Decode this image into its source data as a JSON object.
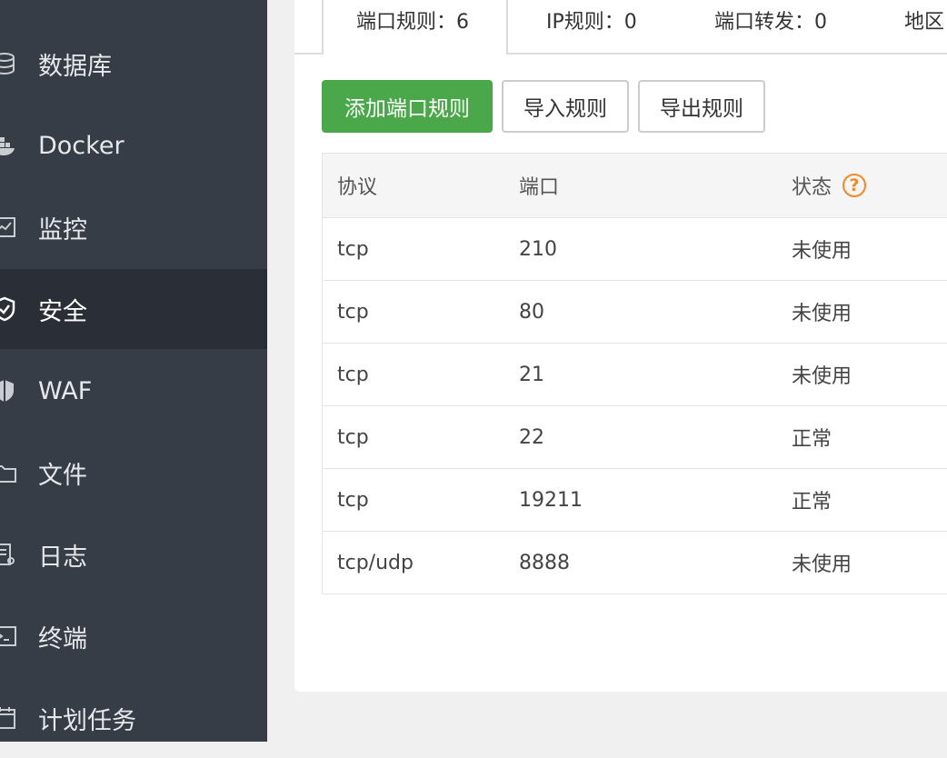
{
  "sidebar": {
    "items": [
      {
        "label": "数据库",
        "icon": "database-icon"
      },
      {
        "label": "Docker",
        "icon": "docker-icon"
      },
      {
        "label": "监控",
        "icon": "monitor-icon"
      },
      {
        "label": "安全",
        "icon": "shield-icon",
        "active": true
      },
      {
        "label": "WAF",
        "icon": "waf-icon"
      },
      {
        "label": "文件",
        "icon": "folder-icon"
      },
      {
        "label": "日志",
        "icon": "log-icon"
      },
      {
        "label": "终端",
        "icon": "terminal-icon"
      },
      {
        "label": "计划任务",
        "icon": "calendar-icon"
      }
    ]
  },
  "tabs": [
    {
      "label": "端口规则：6",
      "active": true
    },
    {
      "label": "IP规则：0"
    },
    {
      "label": "端口转发：0"
    },
    {
      "label": "地区"
    }
  ],
  "toolbar": {
    "add_label": "添加端口规则",
    "import_label": "导入规则",
    "export_label": "导出规则"
  },
  "table": {
    "headers": [
      "协议",
      "端口",
      "状态"
    ],
    "help_glyph": "?",
    "rows": [
      {
        "protocol": "tcp",
        "port": "210",
        "status": "未使用"
      },
      {
        "protocol": "tcp",
        "port": "80",
        "status": "未使用"
      },
      {
        "protocol": "tcp",
        "port": "21",
        "status": "未使用"
      },
      {
        "protocol": "tcp",
        "port": "22",
        "status": "正常"
      },
      {
        "protocol": "tcp",
        "port": "19211",
        "status": "正常"
      },
      {
        "protocol": "tcp/udp",
        "port": "8888",
        "status": "未使用"
      }
    ]
  },
  "colors": {
    "sidebar_bg": "#373d47",
    "sidebar_active_bg": "#2a2e36",
    "primary": "#4aa84b",
    "help": "#f08a24"
  }
}
